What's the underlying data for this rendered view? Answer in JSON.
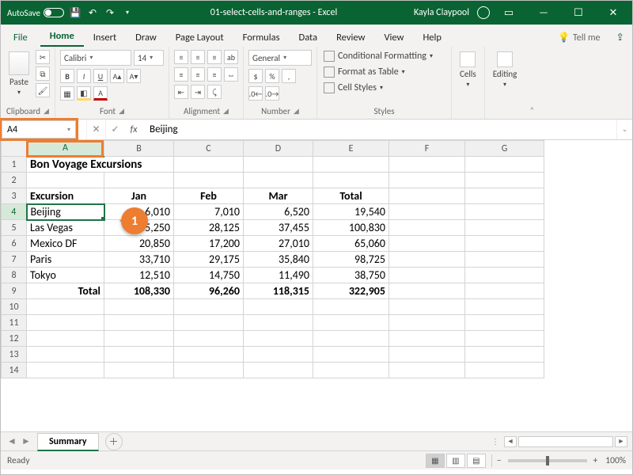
{
  "titlebar": {
    "autosave_label": "AutoSave",
    "doc_title": "01-select-cells-and-ranges - Excel",
    "user_name": "Kayla Claypool"
  },
  "ribbon_tabs": {
    "file": "File",
    "tabs": [
      "Home",
      "Insert",
      "Draw",
      "Page Layout",
      "Formulas",
      "Data",
      "Review",
      "View",
      "Help"
    ],
    "active": "Home",
    "tell_me": "Tell me",
    "share_icon": "share-icon"
  },
  "ribbon": {
    "clipboard": {
      "paste": "Paste",
      "label": "Clipboard"
    },
    "font": {
      "name": "Calibri",
      "size": "14",
      "label": "Font"
    },
    "alignment": {
      "label": "Alignment"
    },
    "number": {
      "format": "General",
      "label": "Number"
    },
    "styles": {
      "cond": "Conditional Formatting",
      "table": "Format as Table",
      "cell": "Cell Styles",
      "label": "Styles"
    },
    "cells": {
      "label": "Cells"
    },
    "editing": {
      "label": "Editing"
    }
  },
  "formula_bar": {
    "name_box": "A4",
    "formula": "Beijing"
  },
  "grid": {
    "columns": [
      "A",
      "B",
      "C",
      "D",
      "E",
      "F",
      "G"
    ],
    "selected_col": "A",
    "selected_row": 4,
    "title": "Bon Voyage Excursions",
    "headers": {
      "c0": "Excursion",
      "c1": "Jan",
      "c2": "Feb",
      "c3": "Mar",
      "c4": "Total"
    },
    "rows": [
      {
        "name": "Beijing",
        "jan": "6,010",
        "feb": "7,010",
        "mar": "6,520",
        "total": "19,540"
      },
      {
        "name": "Las Vegas",
        "jan": "35,250",
        "feb": "28,125",
        "mar": "37,455",
        "total": "100,830"
      },
      {
        "name": "Mexico DF",
        "jan": "20,850",
        "feb": "17,200",
        "mar": "27,010",
        "total": "65,060"
      },
      {
        "name": "Paris",
        "jan": "33,710",
        "feb": "29,175",
        "mar": "35,840",
        "total": "98,725"
      },
      {
        "name": "Tokyo",
        "jan": "12,510",
        "feb": "14,750",
        "mar": "11,490",
        "total": "38,750"
      }
    ],
    "totals": {
      "label": "Total",
      "jan": "108,330",
      "feb": "96,260",
      "mar": "118,315",
      "total": "322,905"
    }
  },
  "callout": {
    "num": "1"
  },
  "sheet_tabs": {
    "active": "Summary"
  },
  "status": {
    "ready": "Ready",
    "zoom": "100%"
  },
  "chart_data": {
    "type": "table",
    "title": "Bon Voyage Excursions",
    "columns": [
      "Excursion",
      "Jan",
      "Feb",
      "Mar",
      "Total"
    ],
    "rows": [
      [
        "Beijing",
        6010,
        7010,
        6520,
        19540
      ],
      [
        "Las Vegas",
        35250,
        28125,
        37455,
        100830
      ],
      [
        "Mexico DF",
        20850,
        17200,
        27010,
        65060
      ],
      [
        "Paris",
        33710,
        29175,
        35840,
        98725
      ],
      [
        "Tokyo",
        12510,
        14750,
        11490,
        38750
      ],
      [
        "Total",
        108330,
        96260,
        118315,
        322905
      ]
    ]
  }
}
